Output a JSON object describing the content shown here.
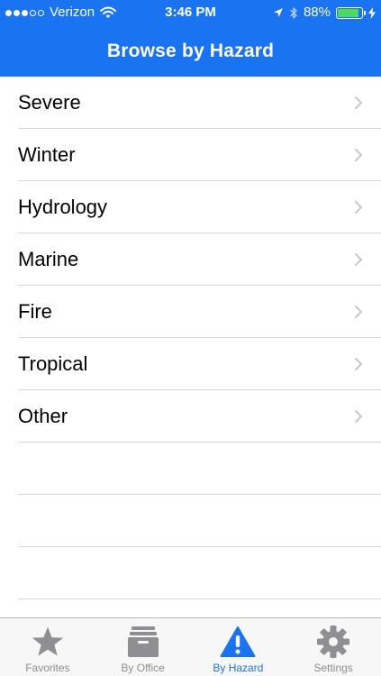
{
  "status_bar": {
    "carrier": "Verizon",
    "time": "3:46 PM",
    "battery_pct": "88%",
    "battery_level": 0.88,
    "signal_bars_filled": 3,
    "signal_bars_total": 5
  },
  "nav": {
    "title": "Browse by Hazard"
  },
  "hazards": [
    {
      "label": "Severe"
    },
    {
      "label": "Winter"
    },
    {
      "label": "Hydrology"
    },
    {
      "label": "Marine"
    },
    {
      "label": "Fire"
    },
    {
      "label": "Tropical"
    },
    {
      "label": "Other"
    }
  ],
  "tabs": [
    {
      "label": "Favorites",
      "icon": "star-icon",
      "active": false
    },
    {
      "label": "By Office",
      "icon": "archive-box-icon",
      "active": false
    },
    {
      "label": "By Hazard",
      "icon": "warning-triangle-icon",
      "active": true
    },
    {
      "label": "Settings",
      "icon": "gear-icon",
      "active": false
    }
  ],
  "colors": {
    "header_blue": "#1a73f0",
    "battery_green": "#4cd964",
    "tab_inactive": "#8e8e93",
    "tab_active": "#1a73f0",
    "separator": "#d6d6db",
    "chevron": "#c7c7cc"
  }
}
